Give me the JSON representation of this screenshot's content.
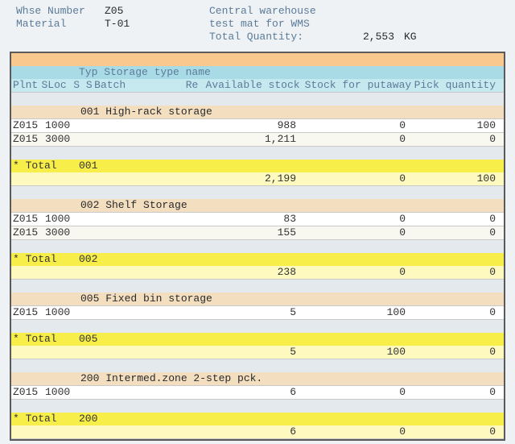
{
  "header": {
    "whse_lbl": "Whse Number",
    "whse_val": "Z05",
    "whse_desc": "Central warehouse",
    "mat_lbl": "Material",
    "mat_val": "T-01",
    "mat_desc": "test mat for WMS",
    "totqty_lbl": "Total Quantity:",
    "totqty_val": "2,553",
    "totqty_uom": "KG"
  },
  "grid_header": {
    "typ_line": "Typ Storage type name",
    "plnt": "Plnt",
    "sloc": "SLoc",
    "sts": "S S",
    "batch": "Batch",
    "re": "Re",
    "avail": "Available stock",
    "put": "Stock for putaway",
    "pick": "Pick quantity"
  },
  "groups": [
    {
      "typ": "001",
      "typ_name": "High-rack storage",
      "rows": [
        {
          "plnt": "Z015",
          "sloc": "1000",
          "avail": "988",
          "put": "0",
          "pick": "100"
        },
        {
          "plnt": "Z015",
          "sloc": "3000",
          "avail": "1,211",
          "put": "0",
          "pick": "0"
        }
      ],
      "total": {
        "label": "* Total",
        "typ": "001",
        "avail": "2,199",
        "put": "0",
        "pick": "100"
      }
    },
    {
      "typ": "002",
      "typ_name": "Shelf Storage",
      "rows": [
        {
          "plnt": "Z015",
          "sloc": "1000",
          "avail": "83",
          "put": "0",
          "pick": "0"
        },
        {
          "plnt": "Z015",
          "sloc": "3000",
          "avail": "155",
          "put": "0",
          "pick": "0"
        }
      ],
      "total": {
        "label": "* Total",
        "typ": "002",
        "avail": "238",
        "put": "0",
        "pick": "0"
      }
    },
    {
      "typ": "005",
      "typ_name": "Fixed bin storage",
      "rows": [
        {
          "plnt": "Z015",
          "sloc": "1000",
          "avail": "5",
          "put": "100",
          "pick": "0"
        }
      ],
      "total": {
        "label": "* Total",
        "typ": "005",
        "avail": "5",
        "put": "100",
        "pick": "0"
      }
    },
    {
      "typ": "200",
      "typ_name": "Intermed.zone 2-step pck.",
      "rows": [
        {
          "plnt": "Z015",
          "sloc": "1000",
          "avail": "6",
          "put": "0",
          "pick": "0"
        }
      ],
      "total": {
        "label": "* Total",
        "typ": "200",
        "avail": "6",
        "put": "0",
        "pick": "0"
      }
    }
  ],
  "chart_data": {
    "type": "table",
    "title": "Warehouse stock by storage type",
    "columns": [
      "Storage Type",
      "Plnt",
      "SLoc",
      "Available stock",
      "Stock for putaway",
      "Pick quantity"
    ],
    "rows": [
      [
        "001 High-rack storage",
        "Z015",
        "1000",
        988,
        0,
        100
      ],
      [
        "001 High-rack storage",
        "Z015",
        "3000",
        1211,
        0,
        0
      ],
      [
        "002 Shelf Storage",
        "Z015",
        "1000",
        83,
        0,
        0
      ],
      [
        "002 Shelf Storage",
        "Z015",
        "3000",
        155,
        0,
        0
      ],
      [
        "005 Fixed bin storage",
        "Z015",
        "1000",
        5,
        100,
        0
      ],
      [
        "200 Intermed.zone 2-step pck.",
        "Z015",
        "1000",
        6,
        0,
        0
      ]
    ],
    "subtotals": [
      {
        "typ": "001",
        "avail": 2199,
        "put": 0,
        "pick": 100
      },
      {
        "typ": "002",
        "avail": 238,
        "put": 0,
        "pick": 0
      },
      {
        "typ": "005",
        "avail": 5,
        "put": 100,
        "pick": 0
      },
      {
        "typ": "200",
        "avail": 6,
        "put": 0,
        "pick": 0
      }
    ],
    "total_quantity": 2553,
    "unit": "KG"
  }
}
